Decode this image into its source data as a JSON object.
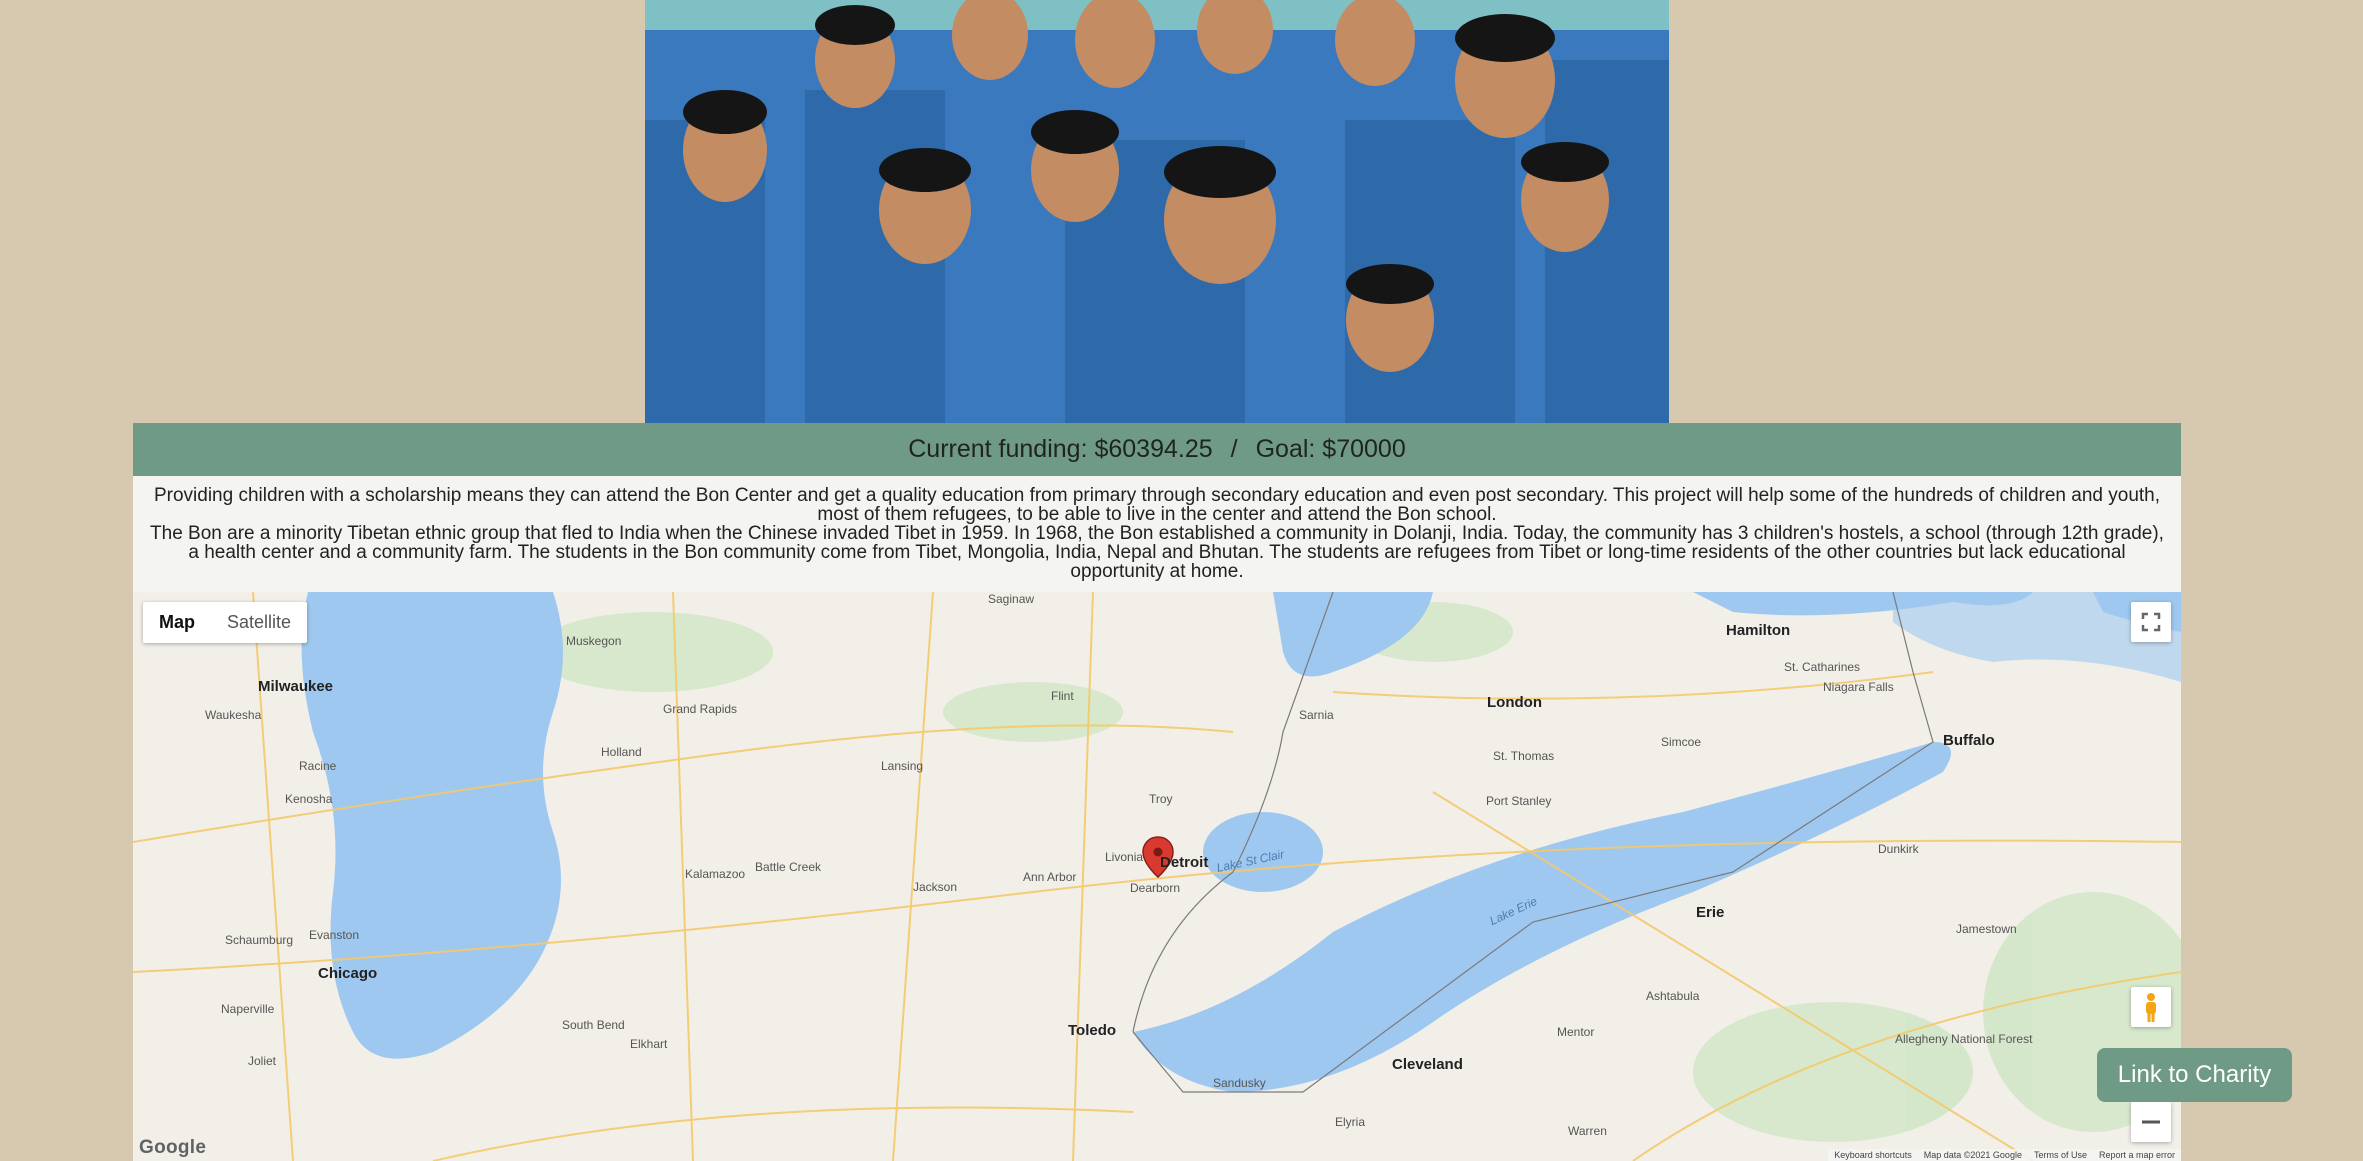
{
  "hero": {
    "image_name": "children-group-photo"
  },
  "funding": {
    "current": "Current funding: $60394.25",
    "separator": "/",
    "goal": "Goal: $70000"
  },
  "description": {
    "paragraph_1": "Providing children with a scholarship means they can attend the Bon Center and get a quality education from primary through secondary education and even post secondary. This project will help some of the hundreds of children and youth, most of them refugees, to be able to live in the center and attend the Bon school.",
    "paragraph_2": "The Bon are a minority Tibetan ethnic group that fled to India when the Chinese invaded Tibet in 1959. In 1968, the Bon established a community in Dolanji, India. Today, the community has 3 children's hostels, a school (through 12th grade), a health center and a community farm. The students in the Bon community come from Tibet, Mongolia, India, Nepal and Bhutan. The students are refugees from Tibet or long-time residents of the other countries but lack educational opportunity at home."
  },
  "map": {
    "type_map": "Map",
    "type_satellite": "Satellite",
    "logo": "Google",
    "attribution": [
      "Keyboard shortcuts",
      "Map data ©2021 Google",
      "Terms of Use",
      "Report a map error"
    ],
    "cities_major": [
      "Milwaukee",
      "Chicago",
      "Detroit",
      "Hamilton",
      "Cleveland",
      "Toledo",
      "Buffalo",
      "London",
      "Erie"
    ],
    "cities": [
      "Grand Rapids",
      "Lansing",
      "Flint",
      "Kalamazoo",
      "Ann Arbor",
      "Dearborn",
      "Livonia",
      "Troy",
      "Sarnia",
      "Kenosha",
      "Racine",
      "Waukesha",
      "Muskegon",
      "Holland",
      "Saginaw",
      "Battle Creek",
      "Jackson",
      "South Bend",
      "Elkhart",
      "Naperville",
      "Schaumburg",
      "Evanston",
      "Joliet",
      "St. Catharines",
      "Niagara Falls",
      "St. Thomas",
      "Sandusky",
      "Elyria",
      "Mentor",
      "Warren",
      "Jamestown",
      "Ashtabula",
      "Dunkirk",
      "Port Stanley",
      "Simcoe",
      "Allegheny National Forest"
    ],
    "lakes": [
      "Lake St Clair",
      "Lake Erie"
    ]
  },
  "cta": {
    "label": "Link to Charity"
  },
  "colors": {
    "page_bg": "#d7c8b0",
    "accent": "#6e9a86",
    "water": "#9fc8f0",
    "land": "#f2efe9"
  }
}
